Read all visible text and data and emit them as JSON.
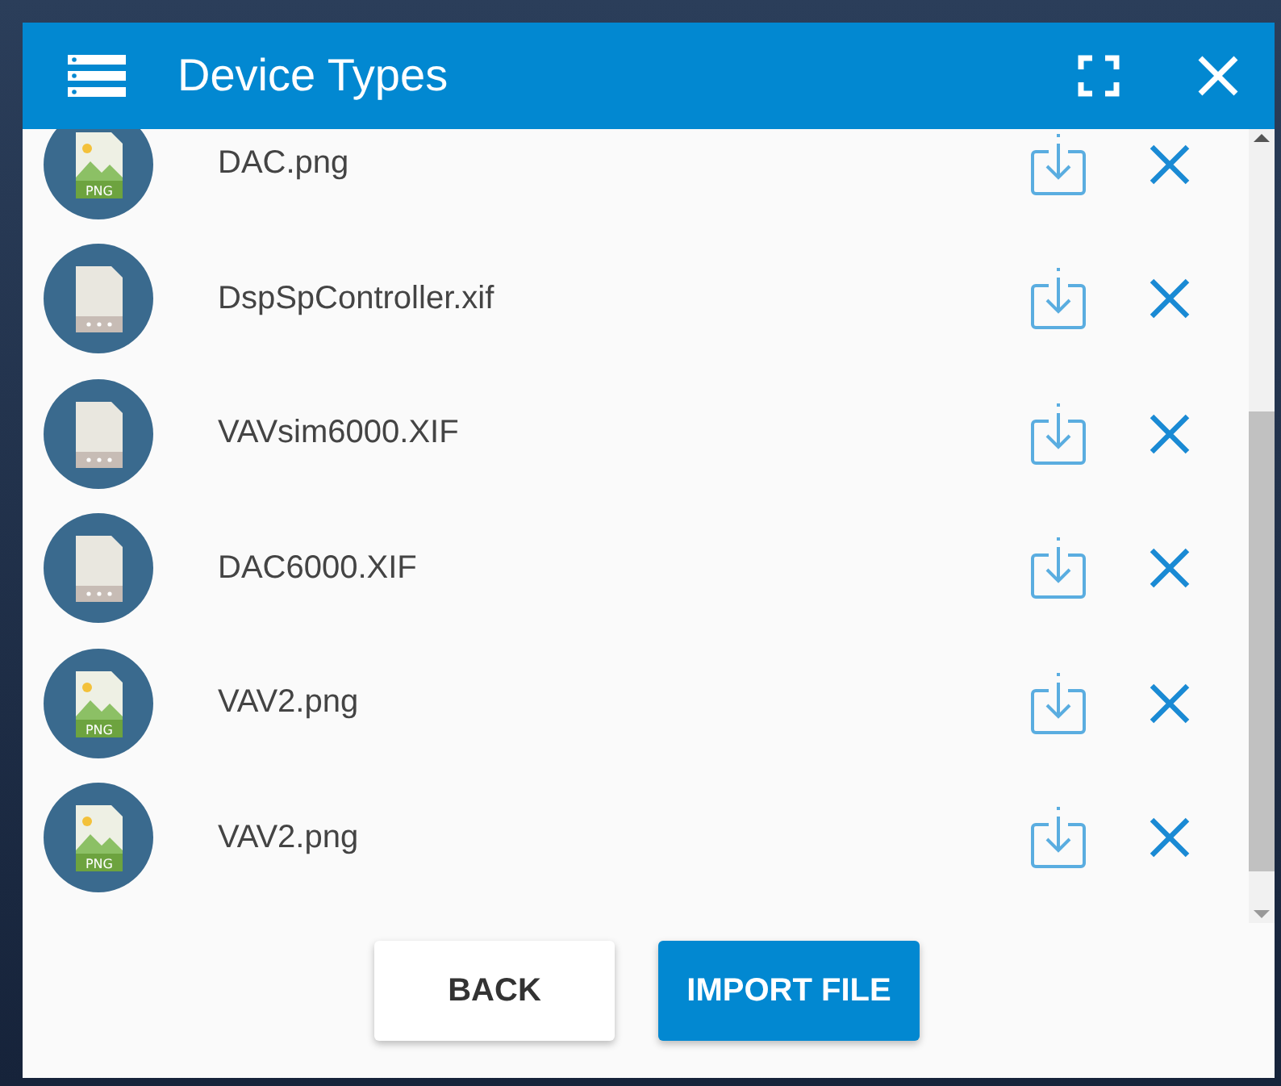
{
  "dialog": {
    "title": "Device Types"
  },
  "files": [
    {
      "name": "DAC.png",
      "kind": "image",
      "icon_label": "PNG"
    },
    {
      "name": "DspSpController.xif",
      "kind": "file"
    },
    {
      "name": "VAVsim6000.XIF",
      "kind": "file"
    },
    {
      "name": "DAC6000.XIF",
      "kind": "file"
    },
    {
      "name": "VAV2.png",
      "kind": "image",
      "icon_label": "PNG"
    },
    {
      "name": "VAV2.png",
      "kind": "image",
      "icon_label": "PNG"
    }
  ],
  "buttons": [
    {
      "label": "BACK",
      "kind": "secondary"
    },
    {
      "label": "IMPORT FILE",
      "kind": "primary"
    }
  ]
}
